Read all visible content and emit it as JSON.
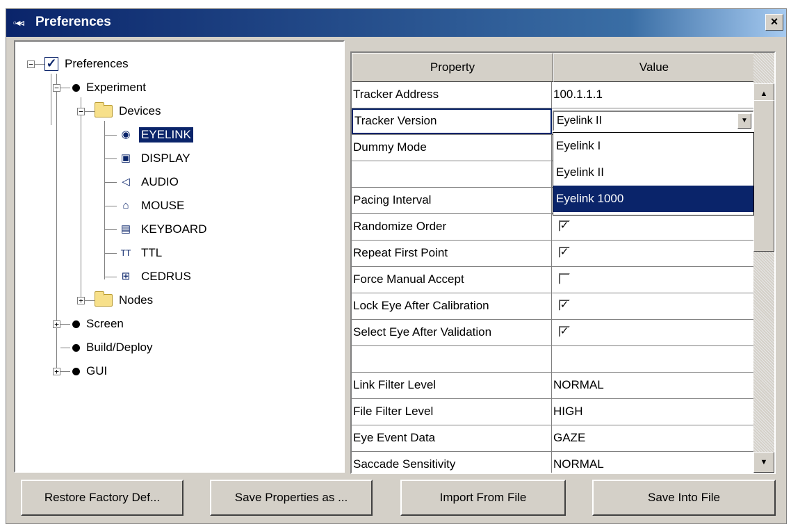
{
  "window": {
    "title": "Preferences",
    "close_label": "×"
  },
  "tree": {
    "root": "Preferences",
    "experiment": "Experiment",
    "devices": "Devices",
    "device_items": [
      "EYELINK",
      "DISPLAY",
      "AUDIO",
      "MOUSE",
      "KEYBOARD",
      "TTL",
      "CEDRUS"
    ],
    "selected": "EYELINK",
    "nodes": "Nodes",
    "screen": "Screen",
    "build_deploy": "Build/Deploy",
    "gui": "GUI"
  },
  "grid": {
    "headers": {
      "property": "Property",
      "value": "Value"
    },
    "rows": [
      {
        "property": "Tracker Address",
        "value": "100.1.1.1"
      },
      {
        "property": "Tracker Version",
        "value": "Eyelink II"
      },
      {
        "property": "Dummy Mode",
        "value": ""
      },
      {
        "property": "",
        "value": ""
      },
      {
        "property": "Pacing Interval",
        "value": ""
      },
      {
        "property": "Randomize Order",
        "checked": true
      },
      {
        "property": "Repeat First Point",
        "checked": true
      },
      {
        "property": "Force Manual Accept",
        "checked": false
      },
      {
        "property": "Lock Eye After Calibration",
        "checked": true
      },
      {
        "property": "Select Eye After Validation",
        "checked": true
      },
      {
        "property": "",
        "value": ""
      },
      {
        "property": "Link Filter Level",
        "value": "NORMAL"
      },
      {
        "property": "File Filter Level",
        "value": "HIGH"
      },
      {
        "property": "Eye Event Data",
        "value": "GAZE"
      },
      {
        "property": "Saccade Sensitivity",
        "value": "NORMAL"
      }
    ],
    "dropdown": {
      "options": [
        "Eyelink I",
        "Eyelink II",
        "Eyelink 1000"
      ],
      "highlighted": "Eyelink 1000"
    }
  },
  "buttons": {
    "restore": "Restore Factory Def...",
    "save_as": "Save Properties as ...",
    "import": "Import From File",
    "save_into": "Save Into File"
  },
  "colors": {
    "title_bar": "#0a246a",
    "selection": "#0a246a",
    "window_bg": "#d4d0c8"
  }
}
